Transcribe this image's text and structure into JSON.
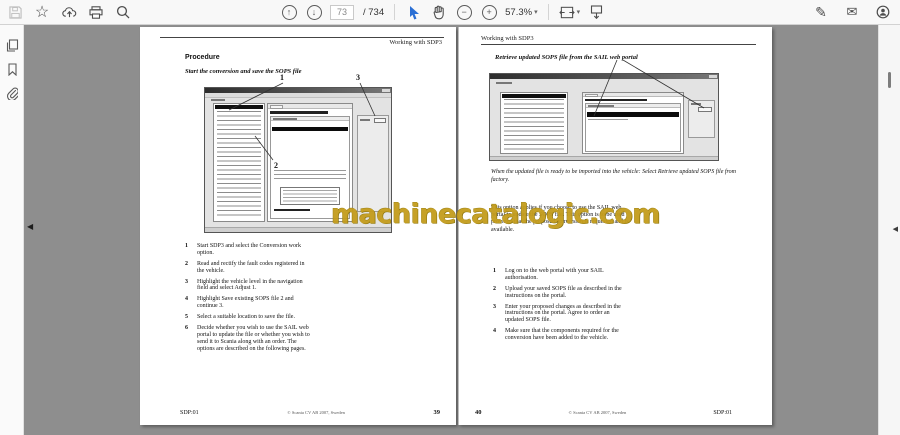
{
  "toolbar": {
    "page_current": "73",
    "page_total": "/ 734",
    "zoom_level": "57.3%"
  },
  "icons": {
    "star": "☆",
    "pen": "✎",
    "envelope": "✉",
    "minus": "−",
    "plus": "+",
    "arrow_up": "↑",
    "arrow_down": "↓",
    "caret_down": "▾",
    "prev_page": "◀",
    "panel_tab": "◀"
  },
  "watermark": {
    "text": "machinecatalogic.com",
    "color": "#c49c1c"
  },
  "pages": {
    "left": {
      "header": "Working with SDP3",
      "heading": "Procedure",
      "subheading": "Start the conversion and save the SOPS file",
      "callouts": [
        "1",
        "2",
        "3"
      ],
      "steps": [
        {
          "num": "1",
          "text": "Start SDP3 and select the Conversion work option."
        },
        {
          "num": "2",
          "text": "Read and rectify the fault codes registered in the vehicle."
        },
        {
          "num": "3",
          "text": "Highlight the vehicle level in the navigation field and select Adjust 1."
        },
        {
          "num": "4",
          "text": "Highlight Save existing SOPS file 2 and continue 3."
        },
        {
          "num": "5",
          "text": "Select a suitable location to save the file."
        },
        {
          "num": "6",
          "text": "Decide whether you wish to use the SAIL web portal to update the file or whether you wish to send it to Scania along with an order. The options are described on the following pages."
        }
      ],
      "footer_left": "SDP:01",
      "footer_center": "© Scania CV AB 2007, Sweden",
      "footer_right": "39"
    },
    "right": {
      "header": "Working with SDP3",
      "heading": "Retrieve updated SOPS file from the SAIL web portal",
      "caption": "When the updated file is ready to be imported into the vehicle: Select Retrieve updated SOPS file from factory.",
      "paragraph": "This option applies if you choose to use the SAIL web portal to update the SOPS file. This option is to be used provided that the proposed conversion is requested and is available.",
      "steps": [
        {
          "num": "1",
          "text": "Log on to the web portal with your SAIL authorisation."
        },
        {
          "num": "2",
          "text": "Upload your saved SOPS file as described in the instructions on the portal."
        },
        {
          "num": "3",
          "text": "Enter your proposed changes as described in the instructions on the portal. Agree to order an updated SOPS file."
        },
        {
          "num": "4",
          "text": "Make sure that the components required for the conversion have been added to the vehicle."
        }
      ],
      "footer_left": "40",
      "footer_center": "© Scania CV AB 2007, Sweden",
      "footer_right": "SDP:01"
    }
  }
}
